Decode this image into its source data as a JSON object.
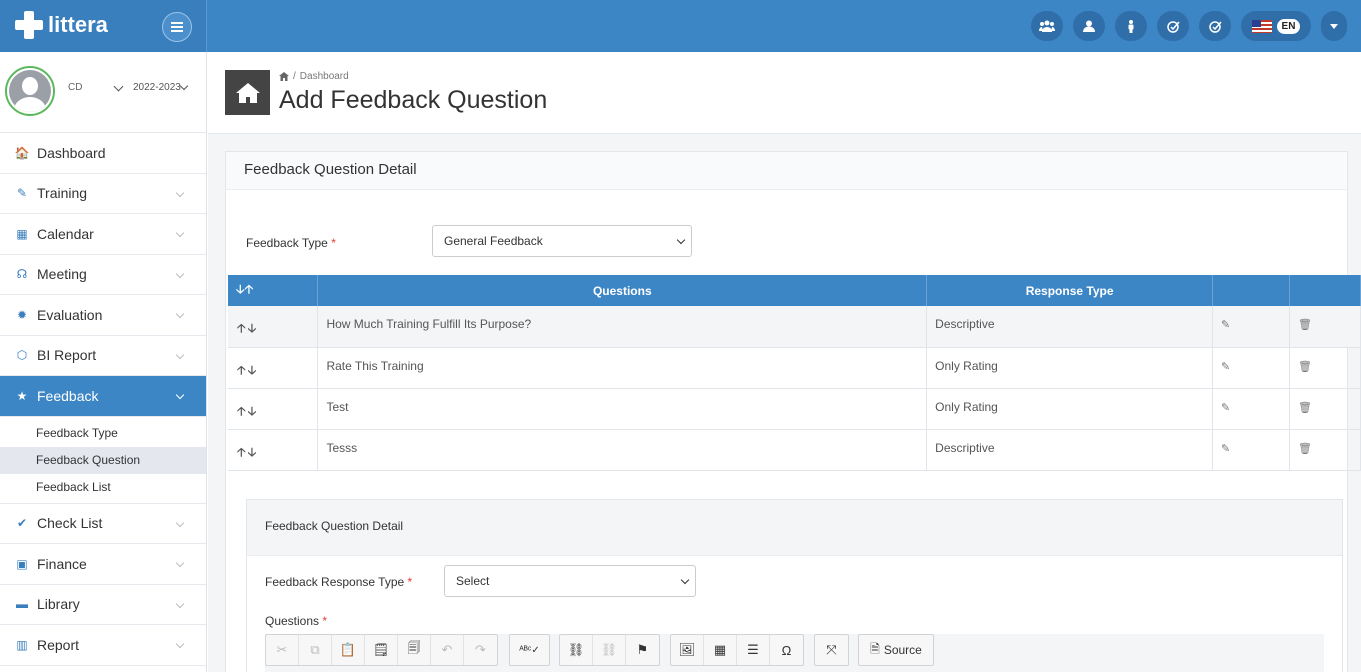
{
  "app": {
    "brand": "littera",
    "language": "EN"
  },
  "profile": {
    "name": "CD",
    "year": "2022-2023"
  },
  "sidebar": {
    "items": [
      {
        "label": "Dashboard",
        "icon": "home-icon",
        "glyph": "🏠"
      },
      {
        "label": "Training",
        "icon": "edit-check-icon",
        "glyph": "✎"
      },
      {
        "label": "Calendar",
        "icon": "calendar-icon",
        "glyph": "▦"
      },
      {
        "label": "Meeting",
        "icon": "headset-icon",
        "glyph": "☊"
      },
      {
        "label": "Evaluation",
        "icon": "gear-icon",
        "glyph": "✹"
      },
      {
        "label": "BI Report",
        "icon": "cube-icon",
        "glyph": "⬡"
      },
      {
        "label": "Feedback",
        "icon": "star-icon",
        "glyph": "★"
      },
      {
        "label": "Check List",
        "icon": "checklist-icon",
        "glyph": "✔"
      },
      {
        "label": "Finance",
        "icon": "money-icon",
        "glyph": "▣"
      },
      {
        "label": "Library",
        "icon": "folder-icon",
        "glyph": "▬"
      },
      {
        "label": "Report",
        "icon": "bar-chart-icon",
        "glyph": "▥"
      }
    ],
    "feedback_sub": [
      "Feedback Type",
      "Feedback Question",
      "Feedback List"
    ]
  },
  "header": {
    "breadcrumb": "Dashboard",
    "title": "Add Feedback Question"
  },
  "panel": {
    "title": "Feedback Question Detail",
    "feedback_type_label": "Feedback Type",
    "feedback_type_value": "General Feedback",
    "table": {
      "headers": [
        "Questions",
        "Response Type"
      ],
      "rows": [
        {
          "question": "How Much Training Fulfill Its Purpose?",
          "response": "Descriptive"
        },
        {
          "question": "Rate This Training",
          "response": "Only Rating"
        },
        {
          "question": "Test",
          "response": "Only Rating"
        },
        {
          "question": "Tesss",
          "response": "Descriptive"
        }
      ]
    }
  },
  "detail": {
    "title": "Feedback Question Detail",
    "response_type_label": "Feedback Response Type",
    "response_type_value": "Select",
    "questions_label": "Questions",
    "source_label": "Source",
    "required_mark": "*"
  }
}
